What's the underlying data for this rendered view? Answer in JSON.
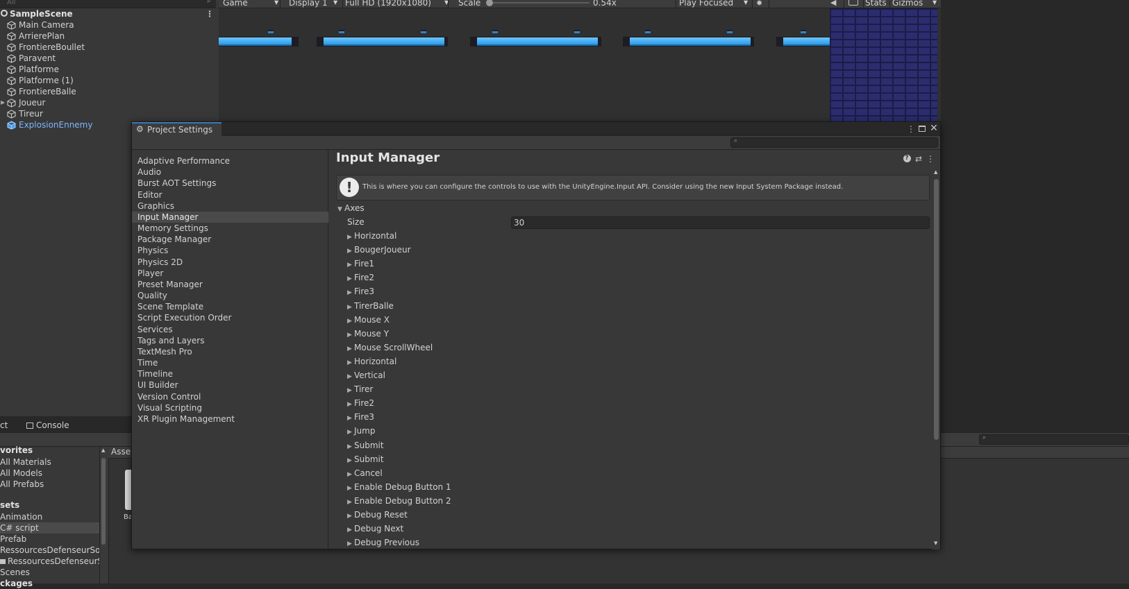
{
  "hierarchy": {
    "search_placeholder": "All",
    "scene_name": "SampleScene",
    "items": [
      {
        "label": "Main Camera"
      },
      {
        "label": "ArrierePlan"
      },
      {
        "label": "FrontiereBoullet"
      },
      {
        "label": "Paravent"
      },
      {
        "label": "Platforme"
      },
      {
        "label": "Platforme (1)"
      },
      {
        "label": "FrontiereBalle"
      },
      {
        "label": "Joueur"
      },
      {
        "label": "Tireur"
      },
      {
        "label": "ExplosionEnnemy",
        "color": "#7cb7ff"
      }
    ]
  },
  "game_toolbar": {
    "view": "Game",
    "display": "Display 1",
    "resolution": "Full HD (1920x1080)",
    "scale_label": "Scale",
    "scale_value": "0.54x",
    "play_mode": "Play Focused",
    "stats": "Stats",
    "gizmos": "Gizmos"
  },
  "bottom": {
    "project_tab_partial": "ct",
    "console_tab": "Console",
    "assets_path": "Asse",
    "asset_label_partial": "Ba",
    "tree": [
      {
        "label": "vorites",
        "bold": true
      },
      {
        "label": "All Materials"
      },
      {
        "label": "All Models"
      },
      {
        "label": "All Prefabs"
      },
      {
        "label": "sets",
        "bold": true
      },
      {
        "label": "Animation"
      },
      {
        "label": "C# script",
        "selected": true
      },
      {
        "label": "Prefab"
      },
      {
        "label": "RessourcesDefenseurSou"
      },
      {
        "label": "RessourcesDefenseurS"
      },
      {
        "label": "Scenes"
      },
      {
        "label": "ckages",
        "bold": true
      }
    ]
  },
  "project_settings": {
    "title": "Project Settings",
    "nav": [
      "Adaptive Performance",
      "Audio",
      "Burst AOT Settings",
      "Editor",
      "Graphics",
      "Input Manager",
      "Memory Settings",
      "Package Manager",
      "Physics",
      "Physics 2D",
      "Player",
      "Preset Manager",
      "Quality",
      "Scene Template",
      "Script Execution Order",
      "Services",
      "Tags and Layers",
      "TextMesh Pro",
      "Time",
      "Timeline",
      "UI Builder",
      "Version Control",
      "Visual Scripting",
      "XR Plugin Management"
    ],
    "selected_nav": "Input Manager",
    "page_title": "Input Manager",
    "info_text": "This is where you can configure the controls to use with the UnityEngine.Input API. Consider using the new Input System Package instead.",
    "axes_label": "Axes",
    "size_label": "Size",
    "size_value": "30",
    "axes": [
      "Horizontal",
      "BougerJoueur",
      "Fire1",
      "Fire2",
      "Fire3",
      "TirerBalle",
      "Mouse X",
      "Mouse Y",
      "Mouse ScrollWheel",
      "Horizontal",
      "Vertical",
      "Tirer",
      "Fire2",
      "Fire3",
      "Jump",
      "Submit",
      "Submit",
      "Cancel",
      "Enable Debug Button 1",
      "Enable Debug Button 2",
      "Debug Reset",
      "Debug Next",
      "Debug Previous"
    ]
  },
  "colors": {
    "accent": "#3a79bb",
    "prefab_blue": "#7cb7ff",
    "platform_blue": "#4fb2f5",
    "brick": "#2b2d6e"
  }
}
